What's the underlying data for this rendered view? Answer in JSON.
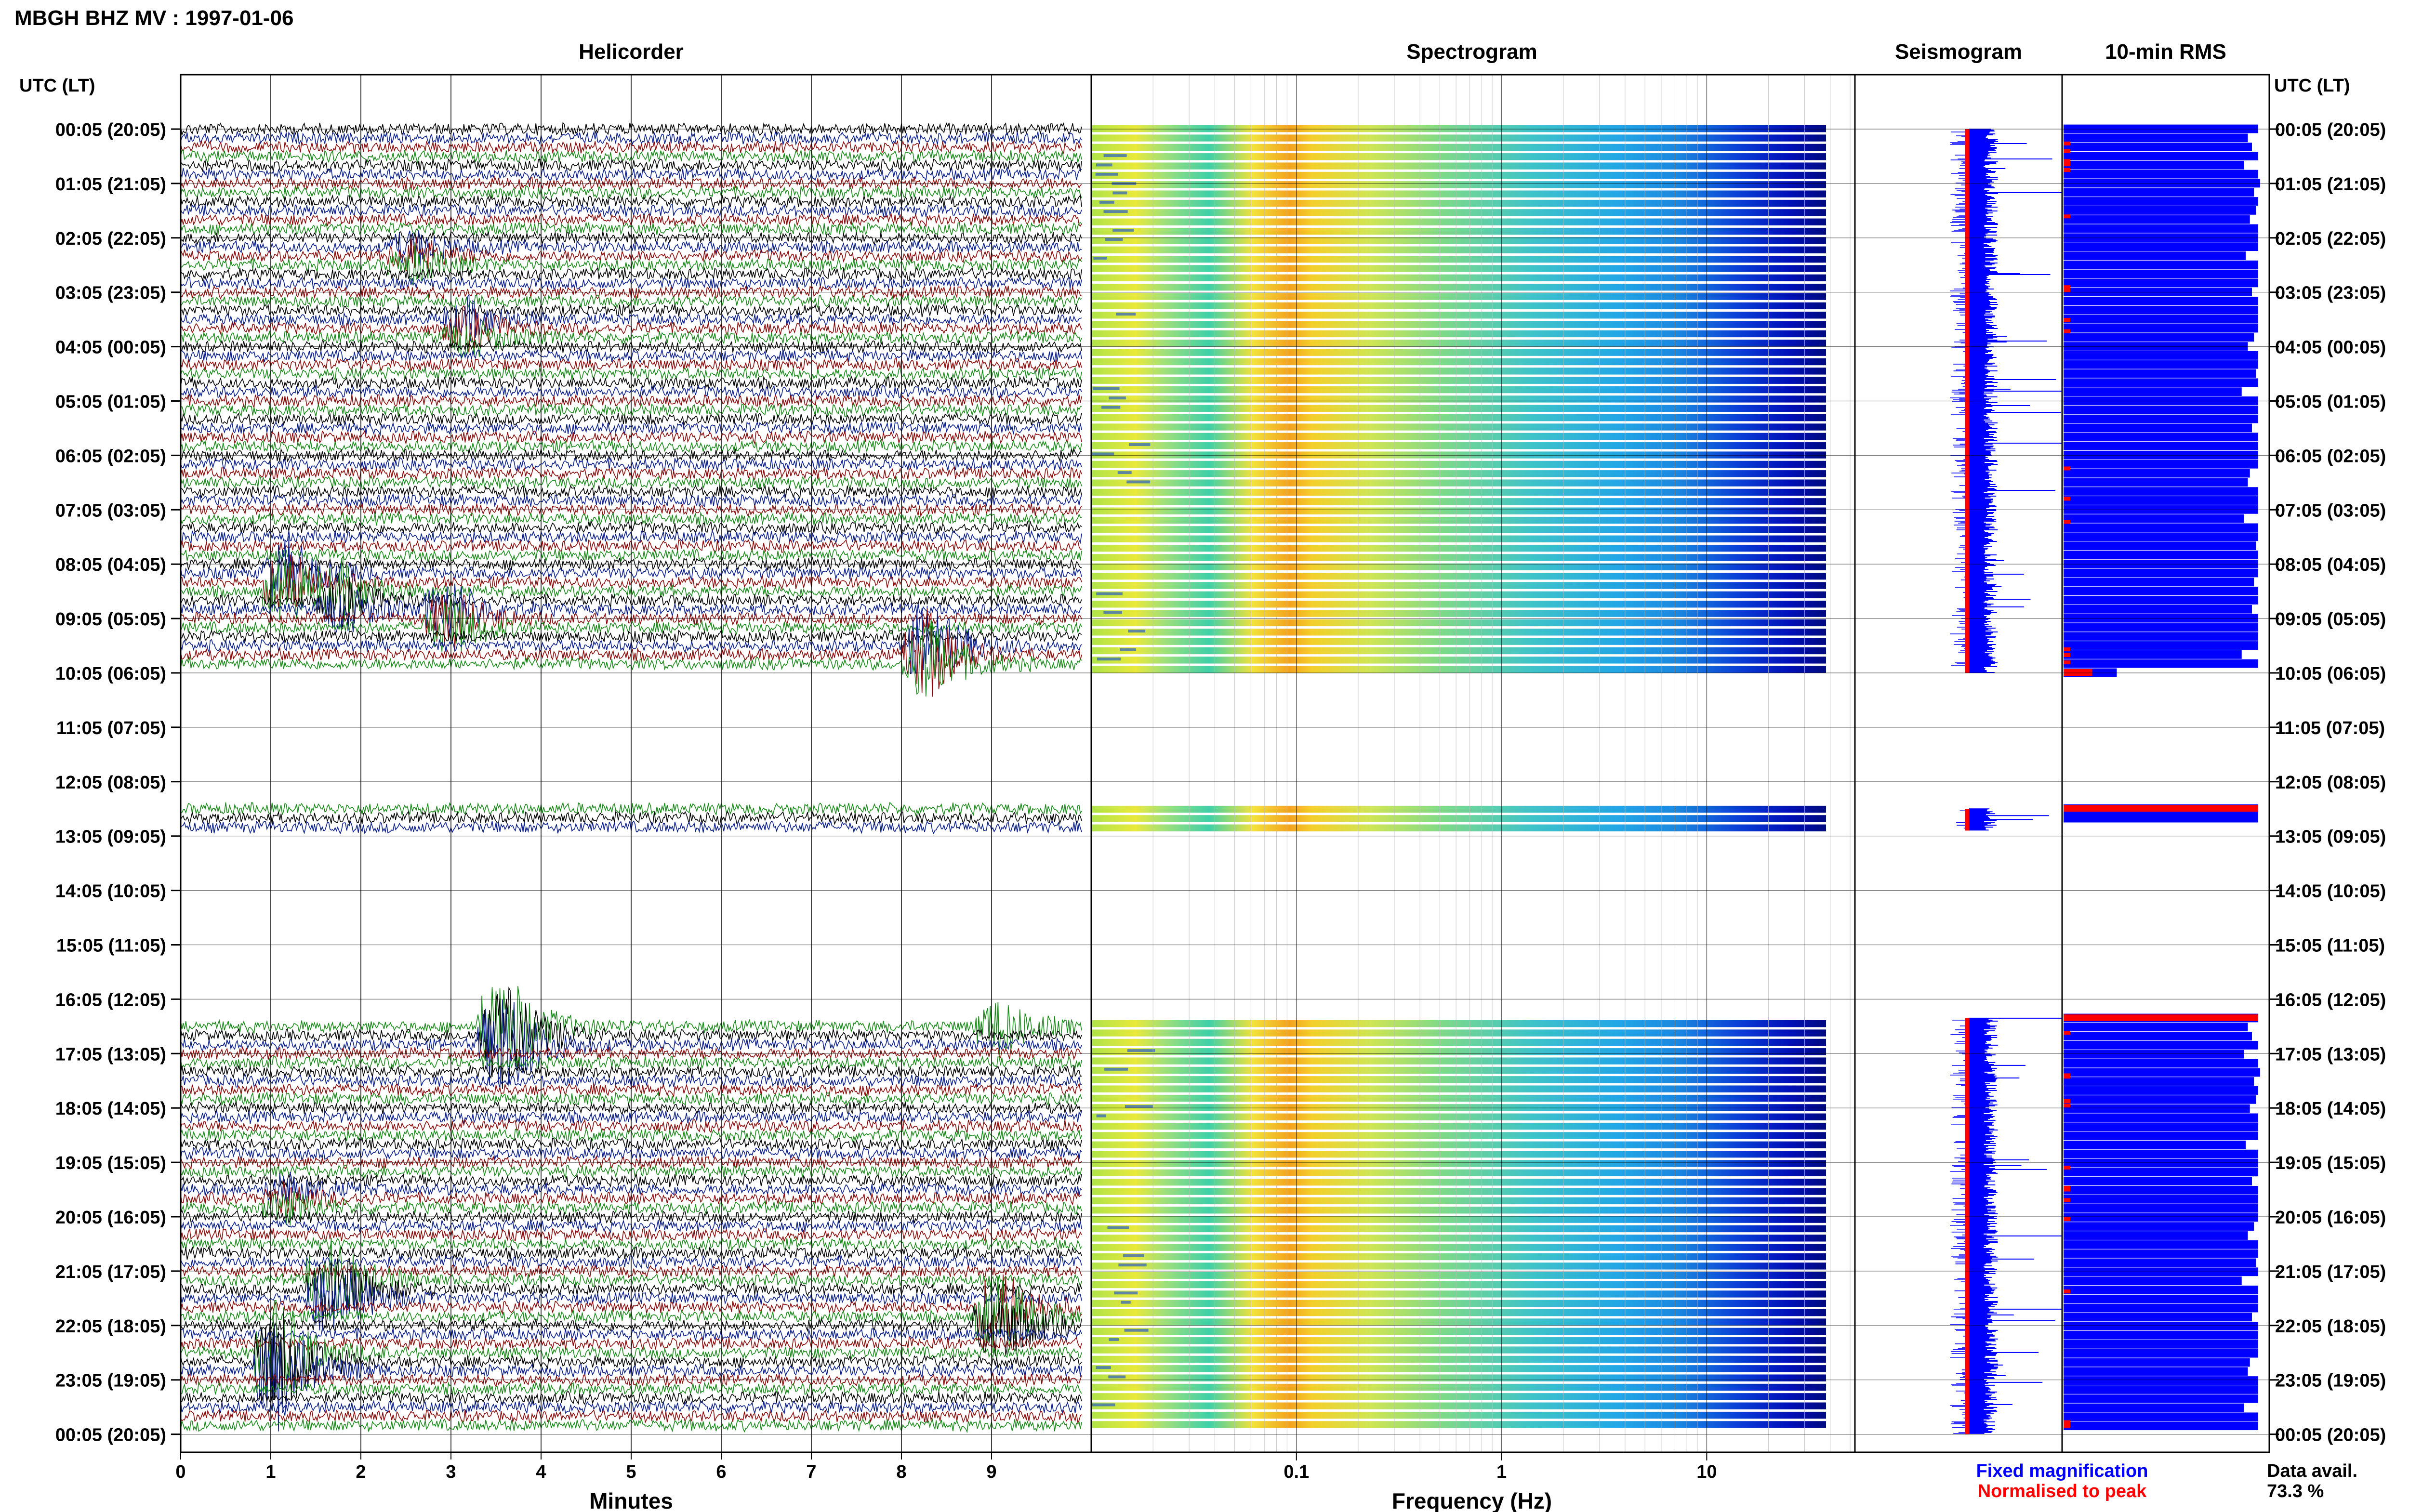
{
  "header": {
    "title": "MBGH BHZ MV : 1997-01-06"
  },
  "panels": {
    "helicorder": "Helicorder",
    "spectrogram": "Spectrogram",
    "seismogram": "Seismogram",
    "rms": "10-min RMS"
  },
  "axes": {
    "time_label_left": "UTC (LT)",
    "time_label_right": "UTC (LT)",
    "minutes_label": "Minutes",
    "frequency_label": "Frequency (Hz)"
  },
  "legend": {
    "fixed": "Fixed magnification",
    "normalised": "Normalised to peak",
    "data_avail_label": "Data avail.",
    "data_avail_value": "73.3 %"
  },
  "colors": {
    "helicorder_traces": [
      "#000000",
      "#0a1e8c",
      "#8b0a0a",
      "#1a8a1a"
    ],
    "fixed": "#0000ff",
    "normalised": "#ff0000"
  },
  "chart_data": [
    {
      "type": "line",
      "name": "helicorder",
      "xlabel": "Minutes",
      "xticks": [
        "0",
        "1",
        "2",
        "3",
        "4",
        "5",
        "6",
        "7",
        "8",
        "9"
      ],
      "xlim": [
        0,
        10
      ],
      "time_ticks": [
        "00:05 (20:05)",
        "01:05 (21:05)",
        "02:05 (22:05)",
        "03:05 (23:05)",
        "04:05 (00:05)",
        "05:05 (01:05)",
        "06:05 (02:05)",
        "07:05 (03:05)",
        "08:05 (04:05)",
        "09:05 (05:05)",
        "10:05 (06:05)",
        "11:05 (07:05)",
        "12:05 (08:05)",
        "13:05 (09:05)",
        "14:05 (10:05)",
        "15:05 (11:05)",
        "16:05 (12:05)",
        "17:05 (13:05)",
        "18:05 (14:05)",
        "19:05 (15:05)",
        "20:05 (16:05)",
        "21:05 (17:05)",
        "22:05 (18:05)",
        "23:05 (19:05)",
        "00:05 (20:05)"
      ],
      "data_intervals_hours": [
        [
          0,
          10
        ],
        [
          12.5,
          12.9
        ],
        [
          16.35,
          24
        ]
      ]
    },
    {
      "type": "heatmap",
      "name": "spectrogram",
      "xlabel": "Frequency (Hz)",
      "xscale": "log",
      "xticks": [
        "0.1",
        "1",
        "10"
      ],
      "xlim": [
        0.01,
        50
      ]
    },
    {
      "type": "line",
      "name": "seismogram",
      "series": [
        {
          "name": "Fixed magnification"
        },
        {
          "name": "Normalised to peak"
        }
      ]
    },
    {
      "type": "bar",
      "name": "rms",
      "orientation": "horizontal",
      "values": [
        0.95,
        0.9,
        0.92,
        0.95,
        0.88,
        0.95,
        0.96,
        0.93,
        0.95,
        0.94,
        0.91,
        0.95,
        0.95,
        0.95,
        0.89,
        0.95,
        0.95,
        0.95,
        0.92,
        0.95,
        0.95,
        0.95,
        0.95,
        0.93,
        0.9,
        0.95,
        0.95,
        0.94,
        0.95,
        0.87,
        0.95,
        0.95,
        0.95,
        0.92,
        0.95,
        0.95,
        0.95,
        0.95,
        0.91,
        0.9,
        0.95,
        0.95,
        0.95,
        0.88,
        0.95,
        0.95,
        0.94,
        0.95,
        0.95,
        0.95,
        0.93,
        0.95,
        0.95,
        0.92,
        0.95,
        0.95,
        0.95,
        0.95,
        0.87,
        0.95,
        0.26
      ]
    }
  ]
}
